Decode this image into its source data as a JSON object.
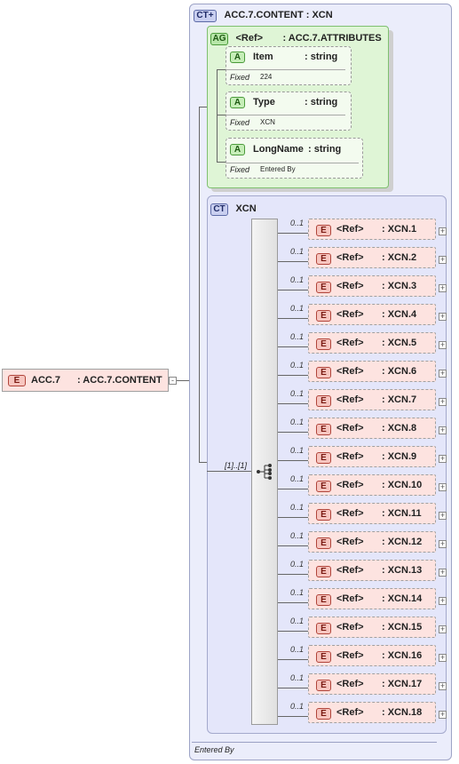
{
  "root": {
    "badge": "E",
    "name": "ACC.7",
    "type": ": ACC.7.CONTENT"
  },
  "content_type": {
    "badge": "CT",
    "title": "ACC.7.CONTENT : XCN"
  },
  "attribute_group": {
    "badge": "AG",
    "ref": "<Ref>",
    "type": ": ACC.7.ATTRIBUTES",
    "attributes": [
      {
        "badge": "A",
        "name": "Item",
        "type": ": string",
        "fixed_label": "Fixed",
        "fixed_value": "224"
      },
      {
        "badge": "A",
        "name": "Type",
        "type": ": string",
        "fixed_label": "Fixed",
        "fixed_value": "XCN"
      },
      {
        "badge": "A",
        "name": "LongName",
        "type": ": string",
        "fixed_label": "Fixed",
        "fixed_value": "Entered By"
      }
    ]
  },
  "xcn_type": {
    "badge": "CT",
    "title": "XCN",
    "sequence_occurrence": "[1]..[1]"
  },
  "elements": [
    {
      "badge": "E",
      "occurrence": "0..1",
      "ref": "<Ref>",
      "name": ": XCN.1"
    },
    {
      "badge": "E",
      "occurrence": "0..1",
      "ref": "<Ref>",
      "name": ": XCN.2"
    },
    {
      "badge": "E",
      "occurrence": "0..1",
      "ref": "<Ref>",
      "name": ": XCN.3"
    },
    {
      "badge": "E",
      "occurrence": "0..1",
      "ref": "<Ref>",
      "name": ": XCN.4"
    },
    {
      "badge": "E",
      "occurrence": "0..1",
      "ref": "<Ref>",
      "name": ": XCN.5"
    },
    {
      "badge": "E",
      "occurrence": "0..1",
      "ref": "<Ref>",
      "name": ": XCN.6"
    },
    {
      "badge": "E",
      "occurrence": "0..1",
      "ref": "<Ref>",
      "name": ": XCN.7"
    },
    {
      "badge": "E",
      "occurrence": "0..1",
      "ref": "<Ref>",
      "name": ": XCN.8"
    },
    {
      "badge": "E",
      "occurrence": "0..1",
      "ref": "<Ref>",
      "name": ": XCN.9"
    },
    {
      "badge": "E",
      "occurrence": "0..1",
      "ref": "<Ref>",
      "name": ": XCN.10"
    },
    {
      "badge": "E",
      "occurrence": "0..1",
      "ref": "<Ref>",
      "name": ": XCN.11"
    },
    {
      "badge": "E",
      "occurrence": "0..1",
      "ref": "<Ref>",
      "name": ": XCN.12"
    },
    {
      "badge": "E",
      "occurrence": "0..1",
      "ref": "<Ref>",
      "name": ": XCN.13"
    },
    {
      "badge": "E",
      "occurrence": "0..1",
      "ref": "<Ref>",
      "name": ": XCN.14"
    },
    {
      "badge": "E",
      "occurrence": "0..1",
      "ref": "<Ref>",
      "name": ": XCN.15"
    },
    {
      "badge": "E",
      "occurrence": "0..1",
      "ref": "<Ref>",
      "name": ": XCN.16"
    },
    {
      "badge": "E",
      "occurrence": "0..1",
      "ref": "<Ref>",
      "name": ": XCN.17"
    },
    {
      "badge": "E",
      "occurrence": "0..1",
      "ref": "<Ref>",
      "name": ": XCN.18"
    }
  ],
  "footer": {
    "annotation": "Entered By"
  }
}
